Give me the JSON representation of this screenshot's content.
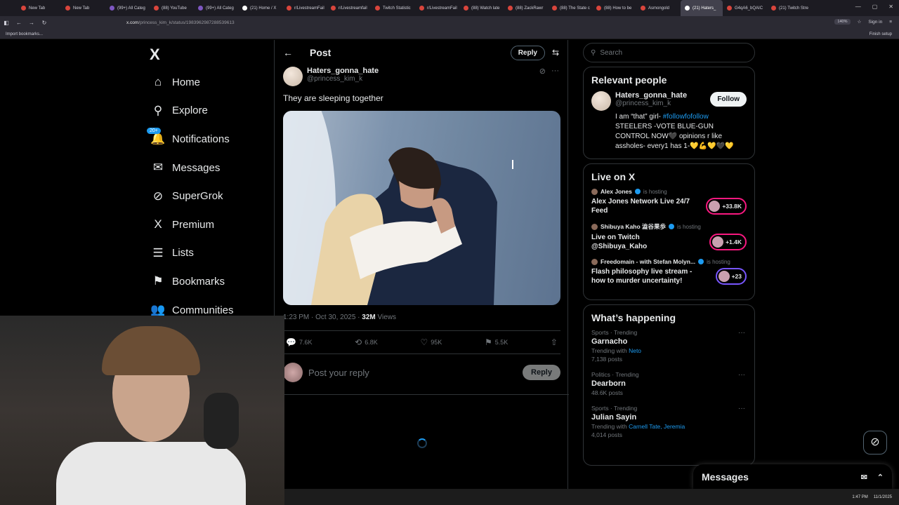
{
  "browser": {
    "tabs": [
      "New Tab",
      "New Tab",
      "(99+) All Categ",
      "(88) YouTube",
      "(99+) All Categ",
      "(21) Home / X",
      "r/LivestreamFail",
      "r/Livestreamfail",
      "Twitch Statistic",
      "r/LivestreamFail",
      "(88) Watch late",
      "(88) ZackRawr",
      "(88) The State c",
      "(88) How to be",
      "Asmongold",
      "(21) Haters_",
      "G4qA6_bQAIC",
      "(21) Twitch Stre"
    ],
    "active_tab": 15,
    "url_host": "x.com",
    "url_path": "/princess_kim_k/status/1983962987288539613",
    "zoom": "140%",
    "sign_in": "Sign in",
    "import_bookmarks": "Import bookmarks...",
    "finish_setup": "Finish setup"
  },
  "sidebar": {
    "logo": "X",
    "items": [
      {
        "label": "Home",
        "icon": "⌂"
      },
      {
        "label": "Explore",
        "icon": "⚲"
      },
      {
        "label": "Notifications",
        "icon": "🔔",
        "badge": "20+"
      },
      {
        "label": "Messages",
        "icon": "✉"
      },
      {
        "label": "SuperGrok",
        "icon": "⊘"
      },
      {
        "label": "Premium",
        "icon": "X"
      },
      {
        "label": "Lists",
        "icon": "☰"
      },
      {
        "label": "Bookmarks",
        "icon": "⚑"
      },
      {
        "label": "Communities",
        "icon": "👥"
      }
    ]
  },
  "post": {
    "header_title": "Post",
    "reply_btn": "Reply",
    "display_name": "Haters_gonna_hate",
    "handle": "@princess_kim_k",
    "text": "They are sleeping together",
    "time": "1:23 PM · Oct 30, 2025 · ",
    "views_count": "32M",
    "views_label": " Views",
    "replies": "7.6K",
    "reposts": "6.8K",
    "likes": "95K",
    "bookmarks": "5.5K",
    "reply_placeholder": "Post your reply",
    "reply_submit": "Reply"
  },
  "right": {
    "search_placeholder": "Search",
    "relevant_title": "Relevant people",
    "person": {
      "name": "Haters_gonna_hate",
      "handle": "@princess_kim_k",
      "follow": "Follow",
      "bio_a": "I am “that” girl- ",
      "bio_hash": "#followfofollow",
      "bio_b": " STEELERS -VOTE BLUE-GUN CONTROL NOW🖤 opinions r like assholes- every1 has 1-💛💪💛🖤💛"
    },
    "live_title": "Live on X",
    "live": [
      {
        "host": "Alex Jones",
        "is": "is hosting",
        "title": "Alex Jones Network Live 24/7 Feed",
        "count": "+33.8K",
        "style": "pink"
      },
      {
        "host": "Shibuya Kaho 澁谷果歩",
        "is": "is hosting",
        "title": "Live on Twitch @Shibuya_Kaho",
        "count": "+1.4K",
        "style": "pink"
      },
      {
        "host": "Freedomain - with Stefan Molyn...",
        "is": "is hosting",
        "title": "Flash philosophy live stream - how to murder uncertainty!",
        "count": "+23",
        "style": "pur"
      }
    ],
    "happening_title": "What’s happening",
    "trends": [
      {
        "meta": "Sports · Trending",
        "name": "Garnacho",
        "sub_a": "Trending with ",
        "sub_link": "Neto",
        "posts": "7,138 posts"
      },
      {
        "meta": "Politics · Trending",
        "name": "Dearborn",
        "sub_a": "",
        "sub_link": "",
        "posts": "48.6K posts"
      },
      {
        "meta": "Sports · Trending",
        "name": "Julian Sayin",
        "sub_a": "Trending with ",
        "sub_link": "Carnell Tate, Jeremia",
        "posts": "4,014 posts"
      }
    ]
  },
  "messages_dock": "Messages",
  "taskbar": {
    "time": "1:47 PM",
    "date": "11/1/2025"
  },
  "colors": {
    "accent": "#1d9bf0",
    "bg": "#000000",
    "border": "#2f3336",
    "muted": "#71767b"
  }
}
